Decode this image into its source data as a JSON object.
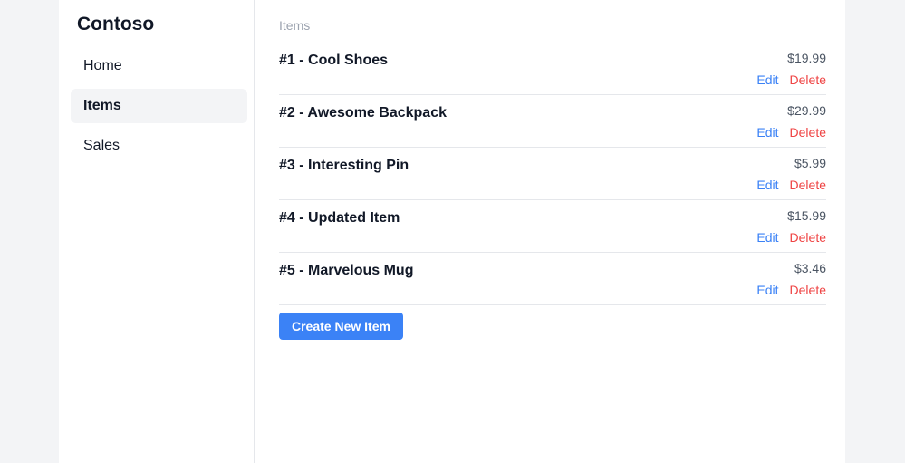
{
  "app": {
    "brand": "Contoso"
  },
  "sidebar": {
    "items": [
      {
        "label": "Home",
        "active": false
      },
      {
        "label": "Items",
        "active": true
      },
      {
        "label": "Sales",
        "active": false
      }
    ]
  },
  "main": {
    "breadcrumb": "Items",
    "items": [
      {
        "name": "#1 - Cool Shoes",
        "price": "$19.99",
        "edit_label": "Edit",
        "delete_label": "Delete"
      },
      {
        "name": "#2 - Awesome Backpack",
        "price": "$29.99",
        "edit_label": "Edit",
        "delete_label": "Delete"
      },
      {
        "name": "#3 - Interesting Pin",
        "price": "$5.99",
        "edit_label": "Edit",
        "delete_label": "Delete"
      },
      {
        "name": "#4 - Updated Item",
        "price": "$15.99",
        "edit_label": "Edit",
        "delete_label": "Delete"
      },
      {
        "name": "#5 - Marvelous Mug",
        "price": "$3.46",
        "edit_label": "Edit",
        "delete_label": "Delete"
      }
    ],
    "create_label": "Create New Item"
  },
  "colors": {
    "accent": "#3b82f6",
    "danger": "#ef4444",
    "page_bg": "#f3f4f6"
  }
}
